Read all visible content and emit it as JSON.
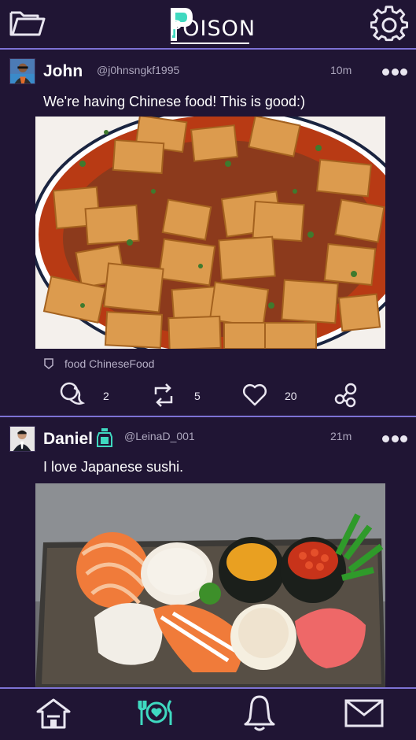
{
  "app": {
    "logo_text": "POISON"
  },
  "icons": {
    "folder": "folder-icon",
    "settings": "gear-icon",
    "home": "home-icon",
    "feed": "dining-icon",
    "notifications": "bell-icon",
    "messages": "mail-icon"
  },
  "posts": [
    {
      "user": "John",
      "handle": "@j0hnsngkf1995",
      "time": "10m",
      "text": "We're having Chinese food! This is good:)",
      "tags": "food ChineseFood",
      "comments": "2",
      "reposts": "5",
      "likes": "20"
    },
    {
      "user": "Daniel",
      "handle": "@LeinaD_001",
      "time": "21m",
      "text": "I love Japanese sushi."
    }
  ],
  "colors": {
    "background": "#201534",
    "divider": "#7d72d4",
    "accent": "#3fd9c0",
    "muted_text": "#aca6bd"
  }
}
